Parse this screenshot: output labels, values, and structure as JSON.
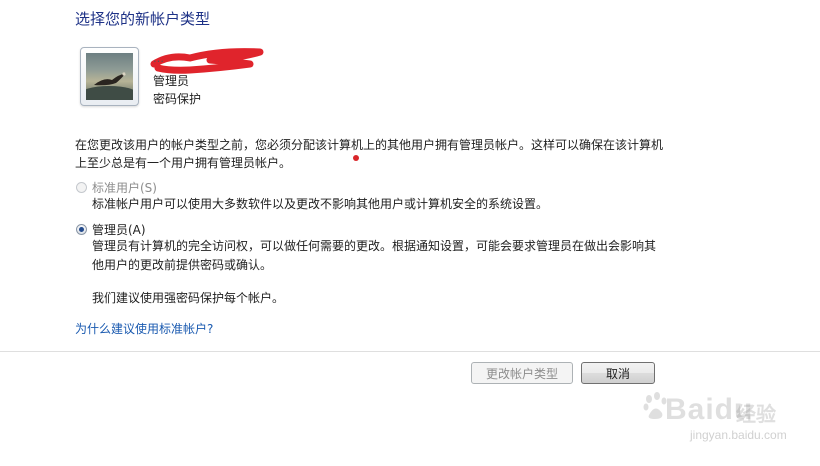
{
  "page": {
    "title": "选择您的新帐户类型"
  },
  "account": {
    "name": "…",
    "type": "管理员",
    "protection": "密码保护"
  },
  "description": "在您更改该用户的帐户类型之前，您必须分配该计算机上的其他用户拥有管理员帐户。这样可以确保在该计算机上至少总是有一个用户拥有管理员帐户。",
  "options": {
    "standard": {
      "label": "标准用户(S)",
      "description": "标准帐户用户可以使用大多数软件以及更改不影响其他用户或计算机安全的系统设置。",
      "selected": false,
      "enabled": false
    },
    "admin": {
      "label": "管理员(A)",
      "description": "管理员有计算机的完全访问权，可以做任何需要的更改。根据通知设置，可能会要求管理员在做出会影响其他用户的更改前提供密码或确认。",
      "note": "我们建议使用强密码保护每个帐户。",
      "selected": true,
      "enabled": true
    }
  },
  "help_link": "为什么建议使用标准帐户?",
  "buttons": {
    "change_type": "更改帐户类型",
    "cancel": "取消"
  },
  "watermark": {
    "brand": "Baidu",
    "sub": "经验",
    "url": "jingyan.baidu.com"
  },
  "colors": {
    "title": "#1e3287",
    "link": "#1a5ab0",
    "redact_mark": "#e0242c"
  }
}
